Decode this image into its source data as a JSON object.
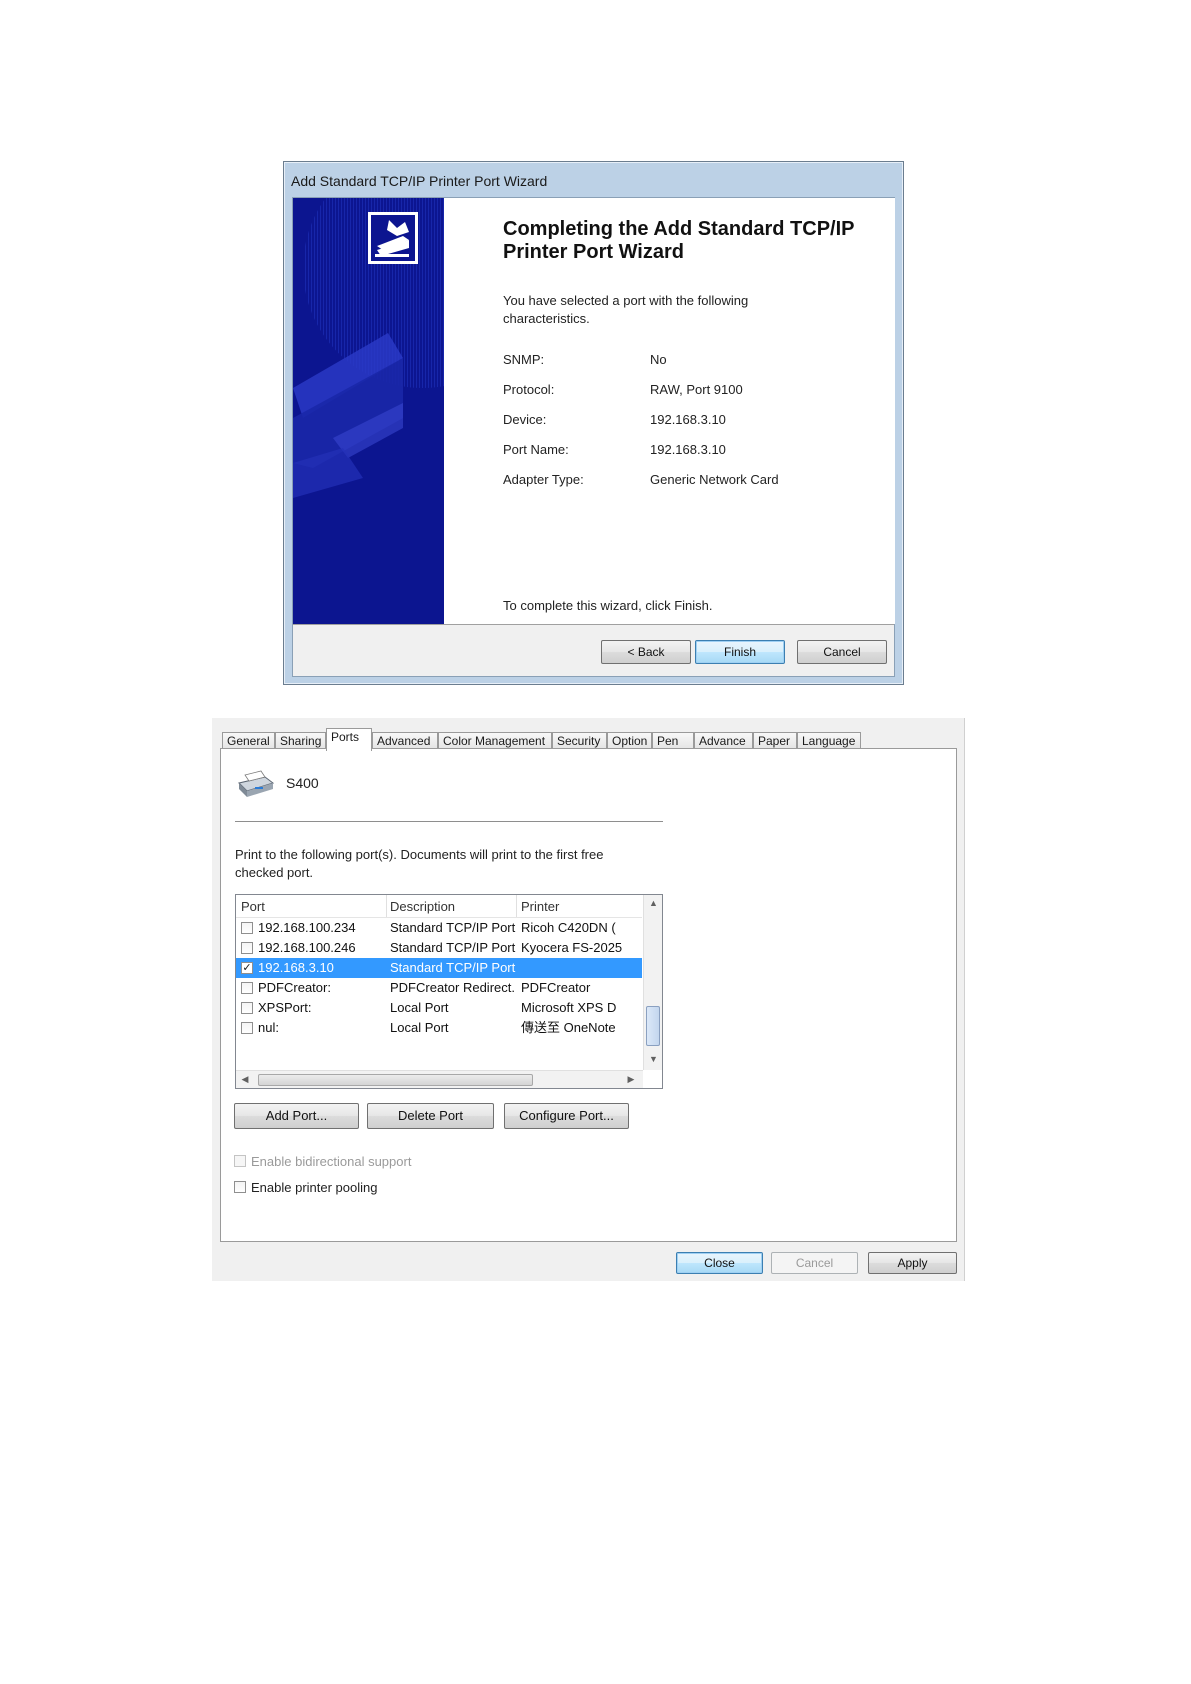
{
  "wizard": {
    "title": "Add Standard TCP/IP Printer Port Wizard",
    "heading": "Completing the Add Standard TCP/IP Printer Port Wizard",
    "intro": "You have selected a port with the following characteristics.",
    "fields": [
      {
        "label": "SNMP:",
        "value": "No"
      },
      {
        "label": "Protocol:",
        "value": "RAW, Port 9100"
      },
      {
        "label": "Device:",
        "value": "192.168.3.10"
      },
      {
        "label": "Port Name:",
        "value": "192.168.3.10"
      },
      {
        "label": "Adapter Type:",
        "value": "Generic Network Card"
      }
    ],
    "finish_hint": "To complete this wizard, click Finish.",
    "buttons": {
      "back": "< Back",
      "finish": "Finish",
      "cancel": "Cancel"
    },
    "banner_color": "#0c1590"
  },
  "properties": {
    "tabs": [
      "General",
      "Sharing",
      "Ports",
      "Advanced",
      "Color Management",
      "Security",
      "Option",
      "Pen",
      "Advance",
      "Paper",
      "Language"
    ],
    "active_tab": "Ports",
    "printer_name": "S400",
    "intro": "Print to the following port(s). Documents will print to the first free checked port.",
    "columns": {
      "port": "Port",
      "description": "Description",
      "printer": "Printer"
    },
    "rows": [
      {
        "port": "192.168.100.234",
        "description": "Standard TCP/IP Port",
        "printer": "Ricoh C420DN (",
        "checked": false,
        "selected": false
      },
      {
        "port": "192.168.100.246",
        "description": "Standard TCP/IP Port",
        "printer": "Kyocera FS-2025",
        "checked": false,
        "selected": false
      },
      {
        "port": "192.168.3.10",
        "description": "Standard TCP/IP Port",
        "printer": "",
        "checked": true,
        "selected": true
      },
      {
        "port": "PDFCreator:",
        "description": "PDFCreator Redirect...",
        "printer": "PDFCreator",
        "checked": false,
        "selected": false
      },
      {
        "port": "XPSPort:",
        "description": "Local Port",
        "printer": "Microsoft XPS D",
        "checked": false,
        "selected": false
      },
      {
        "port": "nul:",
        "description": "Local Port",
        "printer": "傳送至 OneNote",
        "checked": false,
        "selected": false
      }
    ],
    "port_buttons": {
      "add": "Add Port...",
      "delete": "Delete Port",
      "configure": "Configure Port..."
    },
    "options": {
      "bidirectional": {
        "label": "Enable bidirectional support",
        "checked": false,
        "enabled": false
      },
      "pooling": {
        "label": "Enable printer pooling",
        "checked": false,
        "enabled": true
      }
    },
    "dialog_buttons": {
      "close": "Close",
      "cancel": "Cancel",
      "apply": "Apply"
    },
    "selection_color": "#3399ff"
  }
}
